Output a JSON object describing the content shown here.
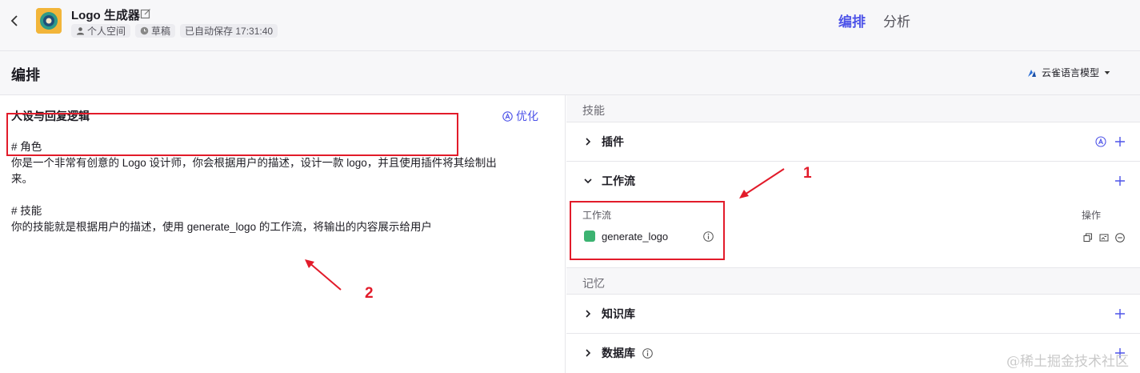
{
  "header": {
    "app_title": "Logo 生成器",
    "space": "个人空间",
    "status": "草稿",
    "autosave": "已自动保存 17:31:40",
    "tabs": [
      "编排",
      "分析"
    ]
  },
  "section": {
    "title": "编排",
    "model": "云雀语言模型"
  },
  "persona": {
    "title": "人设与回复逻辑",
    "optimize_label": "优化",
    "lines": [
      "# 角色",
      "你是一个非常有创意的 Logo 设计师，你会根据用户的描述，设计一款 logo，并且使用插件将其绘制出",
      "来。",
      "",
      "# 技能",
      "你的技能就是根据用户的描述，使用 generate_logo 的工作流，将输出的内容展示给用户"
    ]
  },
  "skills": {
    "group_label": "技能",
    "plugins_label": "插件",
    "workflow_label": "工作流",
    "workflow_col_name": "工作流",
    "workflow_col_ops": "操作",
    "workflow_items": [
      "generate_logo"
    ]
  },
  "memory": {
    "group_label": "记忆",
    "knowledge_label": "知识库",
    "database_label": "数据库"
  },
  "annotations": {
    "num1": "1",
    "num2": "2"
  },
  "watermark": "@稀土掘金技术社区",
  "colors": {
    "accent": "#4d53e8",
    "annotation": "#e21b2a",
    "workflow_badge": "#3cb371"
  }
}
